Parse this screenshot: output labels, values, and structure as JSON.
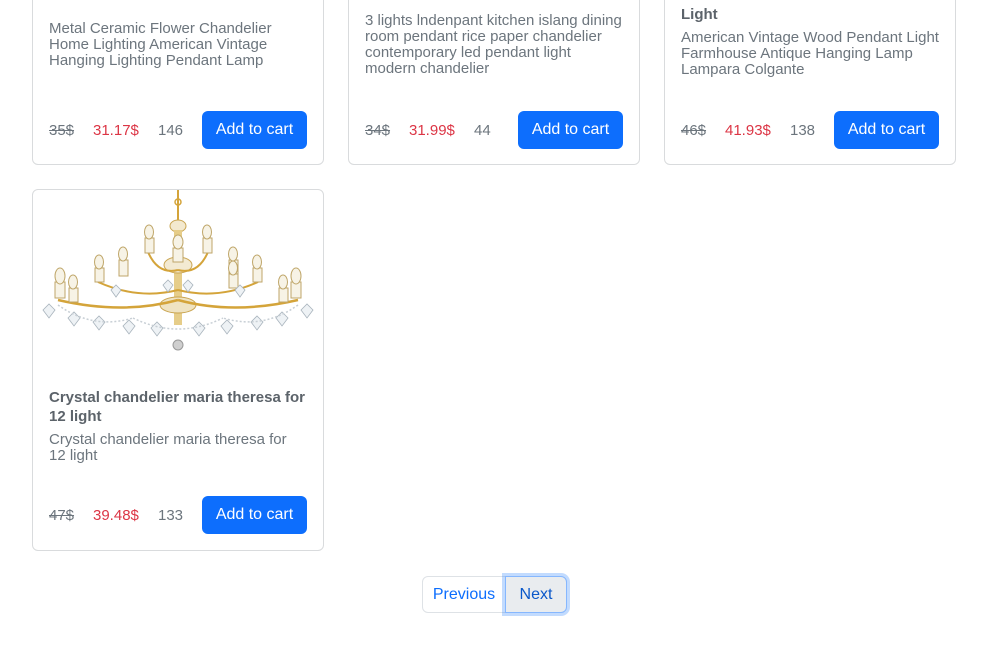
{
  "products": [
    {
      "title": "",
      "description": "Metal Ceramic Flower Chandelier Home Lighting American Vintage Hanging Lighting Pendant Lamp",
      "old_price": "35$",
      "new_price": "31.17$",
      "stock": "146",
      "cart_label": "Add to cart"
    },
    {
      "title": "",
      "description": "3 lights lndenpant kitchen islang dining room pendant rice paper chandelier contemporary led pendant light modern chandelier",
      "old_price": "34$",
      "new_price": "31.99$",
      "stock": "44",
      "cart_label": "Add to cart"
    },
    {
      "title": "Light",
      "description": "American Vintage Wood Pendant Light Farmhouse Antique Hanging Lamp Lampara Colgante",
      "old_price": "46$",
      "new_price": "41.93$",
      "stock": "138",
      "cart_label": "Add to cart"
    },
    {
      "title": "Crystal chandelier maria theresa for 12 light",
      "description": "Crystal chandelier maria theresa for 12 light",
      "old_price": "47$",
      "new_price": "39.48$",
      "stock": "133",
      "cart_label": "Add to cart",
      "image_icon": "crystal-chandelier"
    }
  ],
  "pagination": {
    "previous_label": "Previous",
    "next_label": "Next"
  },
  "colors": {
    "primary": "#0d6efd",
    "sale_price": "#dc3545",
    "muted": "#6c757d"
  }
}
